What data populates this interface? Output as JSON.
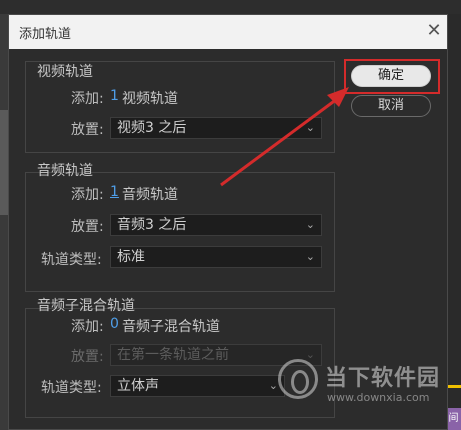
{
  "dialog": {
    "title": "添加轨道",
    "close_glyph": "✕",
    "ok_label": "确定",
    "cancel_label": "取消"
  },
  "video_tracks": {
    "heading": "视频轨道",
    "add_label": "添加:",
    "add_count": "1",
    "add_unit": "视频轨道",
    "place_label": "放置:",
    "place_value": "视频3 之后"
  },
  "audio_tracks": {
    "heading": "音频轨道",
    "add_label": "添加:",
    "add_count": "1",
    "add_unit": "音频轨道",
    "place_label": "放置:",
    "place_value": "音频3 之后",
    "type_label": "轨道类型:",
    "type_value": "标准"
  },
  "submix_tracks": {
    "heading": "音频子混合轨道",
    "add_label": "添加:",
    "add_count": "0",
    "add_unit": "音频子混合轨道",
    "place_label": "放置:",
    "place_value": "在第一条轨道之前",
    "type_label": "轨道类型:",
    "type_value": "立体声"
  },
  "watermark": {
    "main": "当下软件园",
    "sub": "www.downxia.com"
  },
  "background": {
    "corner_badge": "间"
  },
  "colors": {
    "highlight": "#d42b2b",
    "link_number": "#4f9ee8",
    "dialog_bg": "#2c2c2c"
  },
  "icons": {
    "dropdown": "chevron-down-icon",
    "close": "close-icon"
  }
}
